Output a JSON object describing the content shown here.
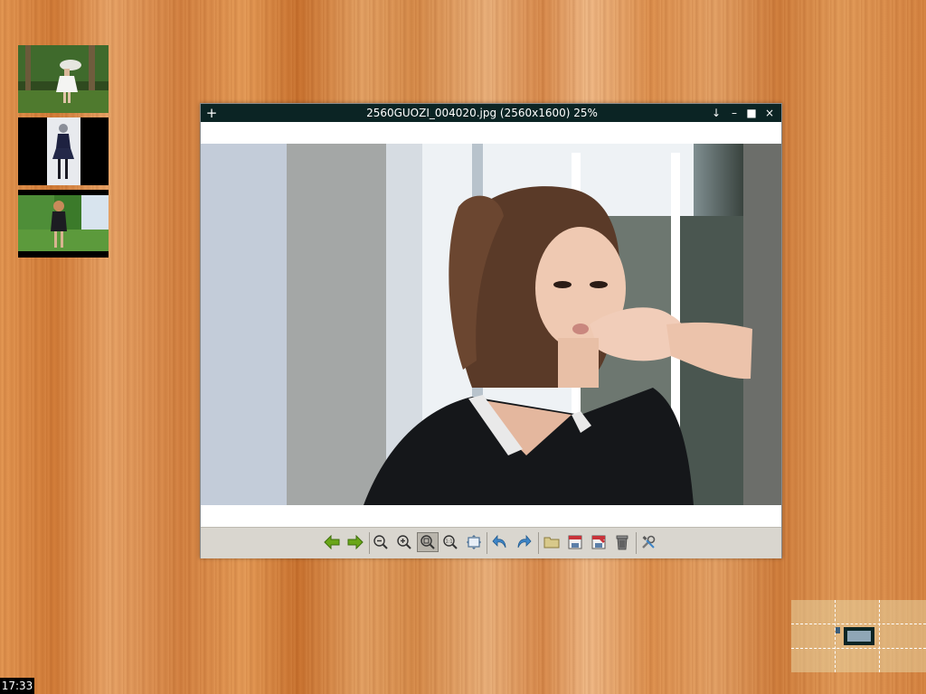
{
  "window": {
    "title": "2560GUOZI_004020.jpg (2560x1600) 25%",
    "plus": "+",
    "minimize": "–",
    "maximize": "■",
    "close": "×",
    "shade": "↓"
  },
  "toolbar": {
    "tools": [
      {
        "name": "previous-image",
        "icon": "arrow-left-icon",
        "color": "#6aa618"
      },
      {
        "name": "next-image",
        "icon": "arrow-right-icon",
        "color": "#6aa618"
      },
      {
        "name": "zoom-out",
        "icon": "zoom-out-icon"
      },
      {
        "name": "zoom-in",
        "icon": "zoom-in-icon"
      },
      {
        "name": "zoom-fit",
        "icon": "zoom-fit-icon",
        "active": true
      },
      {
        "name": "zoom-original",
        "icon": "zoom-original-icon",
        "label": "1:1"
      },
      {
        "name": "fullscreen",
        "icon": "fullscreen-icon"
      },
      {
        "name": "rotate-left",
        "icon": "rotate-left-icon",
        "color": "#3f86c8"
      },
      {
        "name": "rotate-right",
        "icon": "rotate-right-icon",
        "color": "#3f86c8"
      },
      {
        "name": "open-file",
        "icon": "folder-icon"
      },
      {
        "name": "save",
        "icon": "save-icon"
      },
      {
        "name": "save-as",
        "icon": "save-as-icon"
      },
      {
        "name": "delete",
        "icon": "trash-icon"
      },
      {
        "name": "preferences",
        "icon": "tools-icon"
      }
    ]
  },
  "thumbnails": [
    {
      "name": "thumbnail-forest-umbrella"
    },
    {
      "name": "thumbnail-dress-portrait"
    },
    {
      "name": "thumbnail-garden-portrait"
    }
  ],
  "taskbar": {
    "clock": "17:33"
  },
  "colors": {
    "titlebar": "#0b2424",
    "toolbar": "#d9d6cf",
    "accent_green": "#6aa618",
    "accent_blue": "#3f86c8"
  }
}
